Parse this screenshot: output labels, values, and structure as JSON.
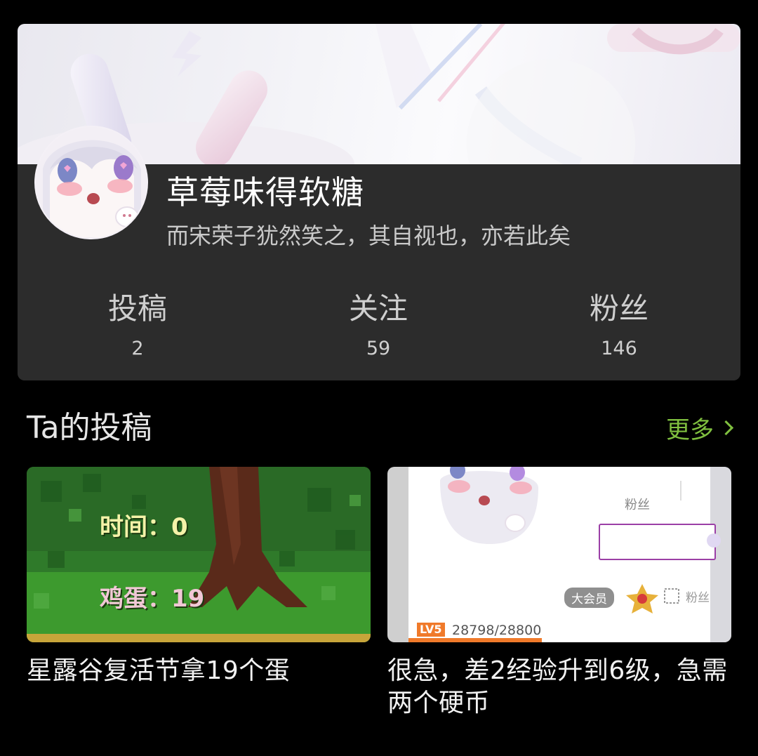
{
  "profile": {
    "username": "草莓味得软糖",
    "signature": "而宋荣子犹然笑之，其自视也，亦若此矣",
    "stats": [
      {
        "label": "投稿",
        "value": "2"
      },
      {
        "label": "关注",
        "value": "59"
      },
      {
        "label": "粉丝",
        "value": "146"
      }
    ]
  },
  "section": {
    "title": "Ta的投稿",
    "more_label": "更多"
  },
  "videos": [
    {
      "title": "星露谷复活节拿19个蛋",
      "thumb_lines": [
        "时间：0",
        "鸡蛋：19"
      ]
    },
    {
      "title": "很急，差2经验升到6级，急需两个硬币",
      "thumb_fans": "粉丝",
      "thumb_vip": "大会员",
      "thumb_fans2": "粉丝",
      "thumb_level": "LV5",
      "thumb_exp": "28798/28800"
    }
  ],
  "colors": {
    "background": "#000000",
    "card": "#2c2c2c",
    "accent_green": "#7fbf3f"
  },
  "icons": {
    "more": "chevron-right-icon"
  }
}
